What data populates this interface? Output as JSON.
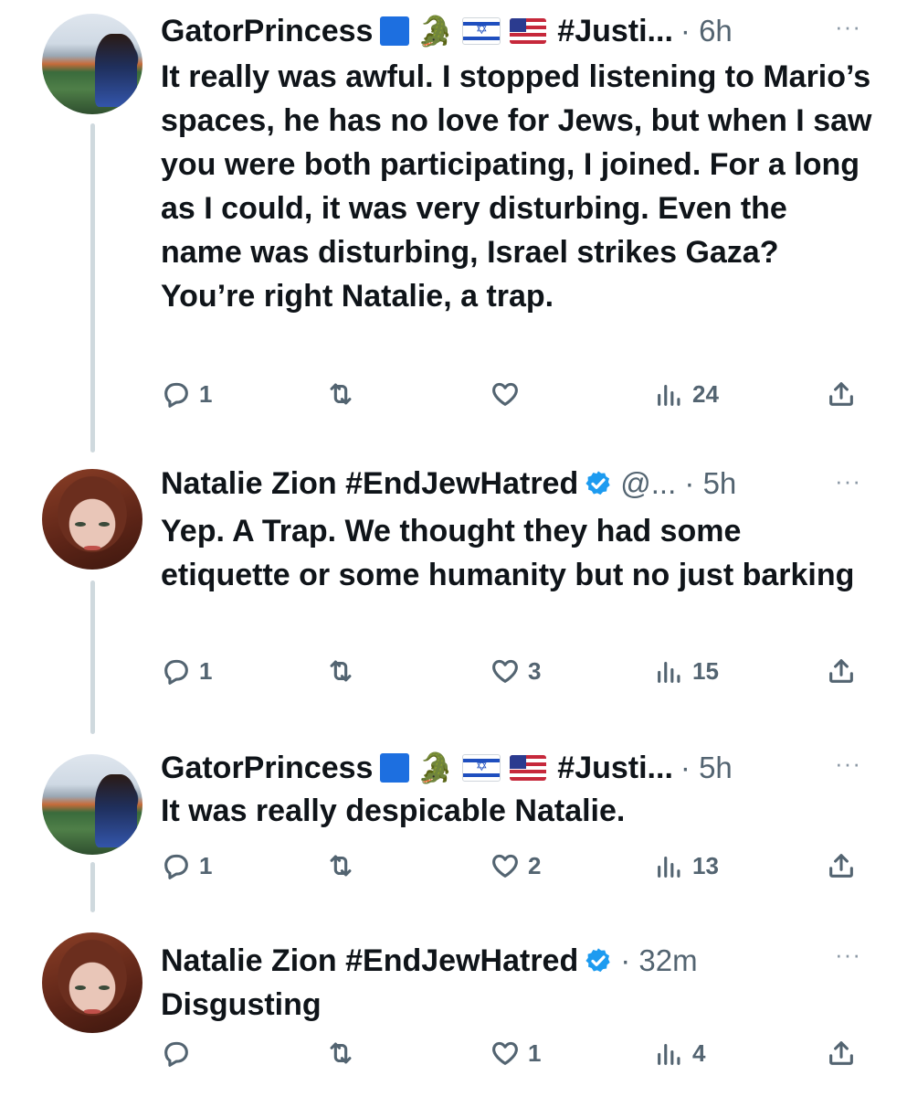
{
  "tweets": [
    {
      "name": "GatorPrincess",
      "hashtag": "#Justi...",
      "meta": "· 6h",
      "more": "···",
      "text": "It really was awful. I stopped listening to Mario’s spaces, he has no love for Jews, but when I saw you were both participating, I joined. For a long as I could, it was very disturbing. Even the name was disturbing, Israel strikes Gaza? You’re right Natalie, a trap.",
      "replies": "1",
      "retweets": "",
      "likes": "",
      "views": "24"
    },
    {
      "name": "Natalie Zion #EndJewHatred",
      "meta": "@... · 5h",
      "more": "···",
      "text": "Yep. A Trap. We thought they had some etiquette or some humanity but no just barking",
      "replies": "1",
      "retweets": "",
      "likes": "3",
      "views": "15"
    },
    {
      "name": "GatorPrincess",
      "hashtag": "#Justi...",
      "meta": "· 5h",
      "more": "···",
      "text": "It was really despicable Natalie.",
      "replies": "1",
      "retweets": "",
      "likes": "2",
      "views": "13"
    },
    {
      "name": "Natalie Zion #EndJewHatred",
      "meta": "· 32m",
      "more": "···",
      "text": "Disgusting",
      "replies": "",
      "retweets": "",
      "likes": "1",
      "views": "4"
    }
  ],
  "icons": {
    "reply": "reply-icon",
    "retweet": "retweet-icon",
    "like": "heart-icon",
    "views": "views-icon",
    "share": "share-icon",
    "verified": "verified-badge-icon",
    "more": "more-options-icon"
  },
  "colors": {
    "text": "#0f1419",
    "secondary": "#536471",
    "verified": "#1d9bf0",
    "thread_line": "#cfd9de",
    "blue_square": "#1d6fe0"
  }
}
